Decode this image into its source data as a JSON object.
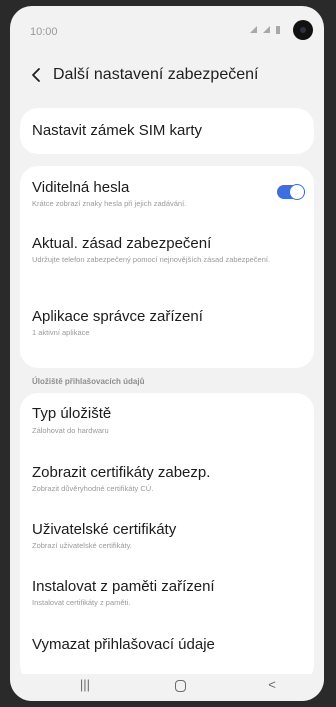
{
  "status_bar": {
    "time": "10:00"
  },
  "header": {
    "title": "Další nastavení zabezpečení"
  },
  "sim_lock": {
    "title": "Nastavit zámek SIM karty"
  },
  "security_items": [
    {
      "title": "Viditelná hesla",
      "subtitle": "Krátce zobrazí znaky hesla při jejich zadávání.",
      "toggle_on": true
    },
    {
      "title": "Aktual. zásad zabezpečení",
      "subtitle": "Udržujte telefon zabezpečený pomocí nejnovějších zásad zabezpečení."
    },
    {
      "title": "Aplikace správce zařízení",
      "subtitle": "1 aktivní aplikace"
    }
  ],
  "storage_section": {
    "header": "Úložiště přihlašovacích údajů",
    "items": [
      {
        "title": "Typ úložiště",
        "subtitle": "Zálohovat do hardwaru"
      },
      {
        "title": "Zobrazit certifikáty zabezp.",
        "subtitle": "Zobrazit důvěryhodné certifikáty CÚ."
      },
      {
        "title": "Uživatelské certifikáty",
        "subtitle": "Zobrazí uživatelské certifikáty."
      },
      {
        "title": "Instalovat z paměti zařízení",
        "subtitle": "Instalovat certifikáty z paměti."
      },
      {
        "title": "Vymazat přihlašovací údaje",
        "subtitle": ""
      }
    ]
  },
  "nav_bar": {
    "recents_glyph": "|||",
    "back_glyph": "<"
  },
  "colors": {
    "accent": "#3e6ee0",
    "background": "#f2f2f2",
    "card": "#ffffff"
  }
}
